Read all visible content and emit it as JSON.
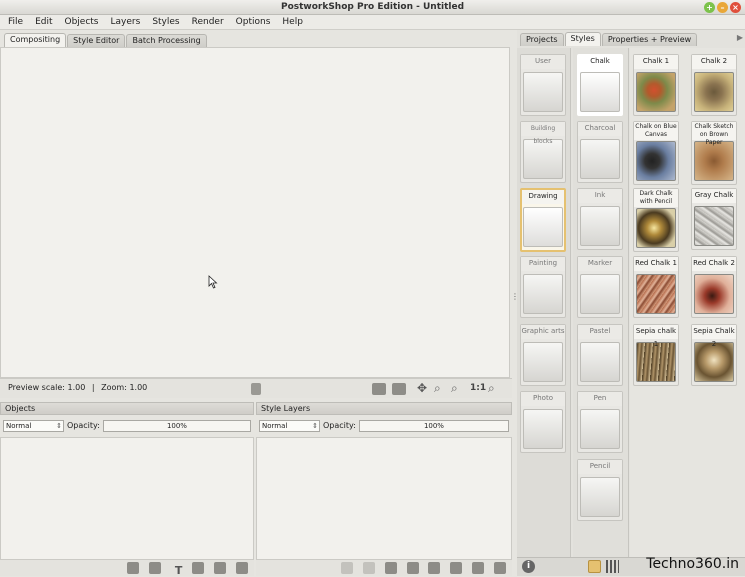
{
  "window": {
    "title": "PostworkShop Pro Edition - Untitled"
  },
  "menu": [
    "File",
    "Edit",
    "Objects",
    "Layers",
    "Styles",
    "Render",
    "Options",
    "Help"
  ],
  "left_tabs": [
    {
      "label": "Compositing",
      "active": true
    },
    {
      "label": "Style Editor",
      "active": false
    },
    {
      "label": "Batch Processing",
      "active": false
    }
  ],
  "right_tabs": [
    {
      "label": "Projects",
      "active": false
    },
    {
      "label": "Styles",
      "active": true
    },
    {
      "label": "Properties + Preview",
      "active": false
    }
  ],
  "status": {
    "preview_scale_label": "Preview scale: 1.00",
    "separator": "|",
    "zoom_label": "Zoom: 1.00",
    "zoom_ratio": "1:1"
  },
  "objects_panel": {
    "title": "Objects",
    "blend_mode": "Normal",
    "opacity_label": "Opacity:",
    "opacity_value": "100%"
  },
  "style_layers_panel": {
    "title": "Style Layers",
    "blend_mode": "Normal",
    "opacity_label": "Opacity:",
    "opacity_value": "100%"
  },
  "style_categories": [
    "User",
    "Building blocks",
    "Drawing",
    "Painting",
    "Graphic arts",
    "Photo"
  ],
  "style_subcategories": [
    "Chalk",
    "Charcoal",
    "Ink",
    "Marker",
    "Pastel",
    "Pen",
    "Pencil"
  ],
  "style_presets": [
    [
      "Chalk 1",
      "Chalk 2"
    ],
    [
      "Chalk on Blue Canvas",
      "Chalk Sketch on Brown Paper"
    ],
    [
      "Dark Chalk with Pencil",
      "Gray Chalk"
    ],
    [
      "Red Chalk 1",
      "Red Chalk 2"
    ],
    [
      "Sepia chalk 1",
      "Sepia Chalk 2"
    ]
  ],
  "watermark": "Techno360.in",
  "colors": {
    "accent": "#e5c170"
  }
}
